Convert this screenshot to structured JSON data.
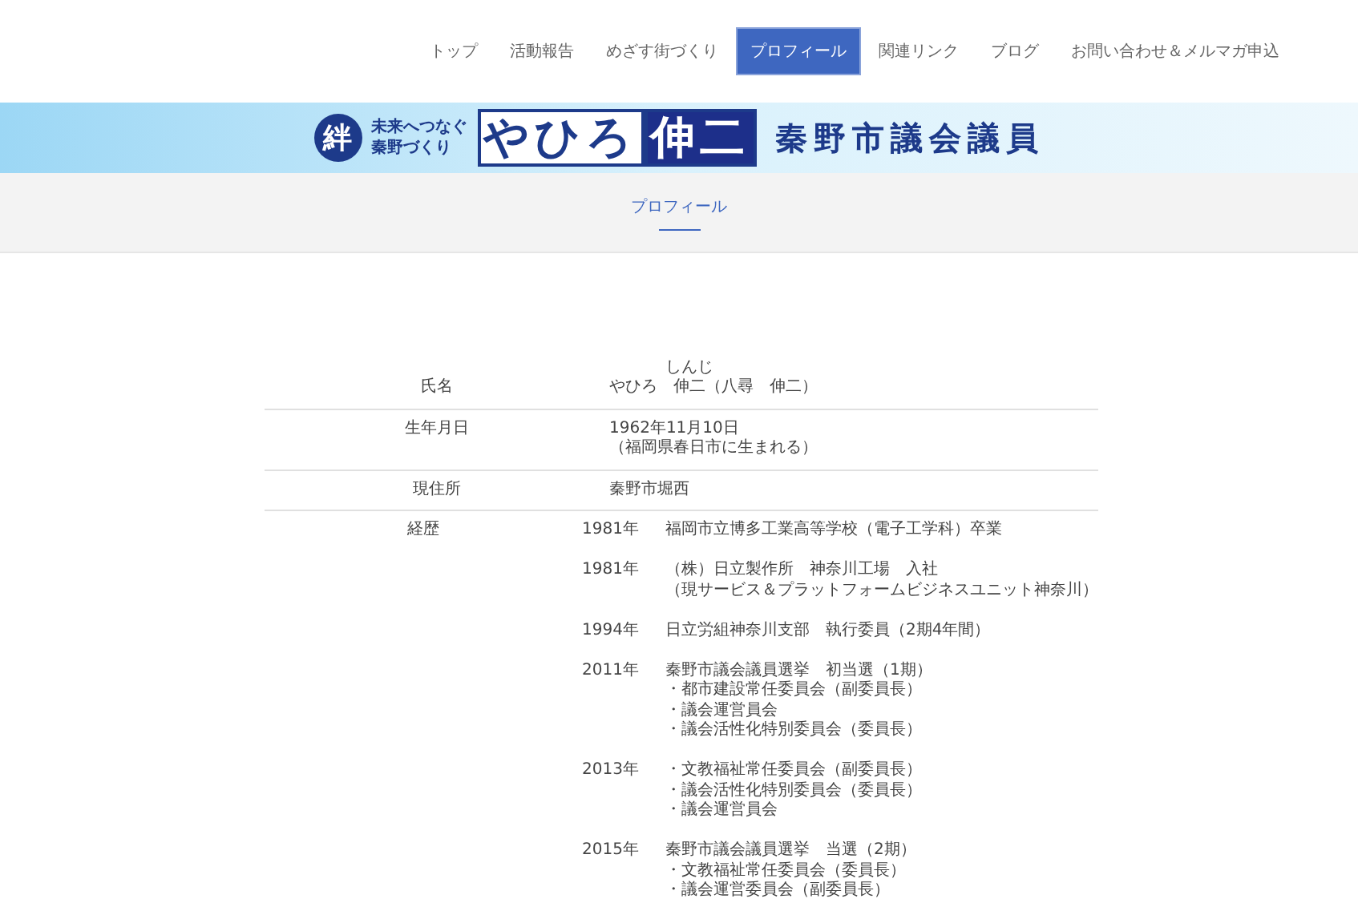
{
  "nav": [
    {
      "label": "トップ",
      "selected": false
    },
    {
      "label": "活動報告",
      "selected": false
    },
    {
      "label": "めざす街づくり",
      "selected": false
    },
    {
      "label": "プロフィール",
      "selected": true
    },
    {
      "label": "関連リンク",
      "selected": false
    },
    {
      "label": "ブログ",
      "selected": false
    },
    {
      "label": "お問い合わせ＆メルマガ申込",
      "selected": false
    }
  ],
  "banner": {
    "emblem": "絆",
    "slogan_lines": [
      "未来へつなぐ",
      "秦野づくり"
    ],
    "family_name": "やひろ",
    "given_name": "伸二",
    "role": "秦野市議会議員"
  },
  "page_title": "プロフィール",
  "profile": {
    "name": {
      "family": "やひろ",
      "given": "伸二",
      "given_reading": "しんじ",
      "kanji": "（八尋　伸二）"
    },
    "rows": [
      {
        "label": "氏名",
        "kind": "name"
      },
      {
        "label": "生年月日",
        "kind": "lines",
        "lines": [
          "1962年11月10日",
          "（福岡県春日市に生まれる）"
        ]
      },
      {
        "label": "現住所",
        "kind": "lines",
        "lines": [
          "秦野市堀西"
        ]
      },
      {
        "label": "経歴",
        "kind": "career",
        "entries": [
          {
            "year": "1981年",
            "lines": [
              "福岡市立博多工業高等学校（電子工学科）卒業"
            ]
          },
          {
            "year": "1981年",
            "lines": [
              "（株）日立製作所　神奈川工場　入社",
              "（現サービス＆プラットフォームビジネスユニット神奈川）"
            ]
          },
          {
            "year": "1994年",
            "lines": [
              "日立労組神奈川支部　執行委員（2期4年間）"
            ]
          },
          {
            "year": "2011年",
            "lines": [
              "秦野市議会議員選挙　初当選（1期）",
              "・都市建設常任委員会（副委員長）",
              "・議会運営員会",
              "・議会活性化特別委員会（委員長）"
            ]
          },
          {
            "year": "2013年",
            "lines": [
              "・文教福祉常任委員会（副委員長）",
              "・議会活性化特別委員会（委員長）",
              "・議会運営員会"
            ]
          },
          {
            "year": "2015年",
            "lines": [
              "秦野市議会議員選挙　当選（2期）",
              "・文教福祉常任委員会（委員長）",
              "・議会運営委員会（副委員長）"
            ]
          }
        ]
      }
    ]
  }
}
